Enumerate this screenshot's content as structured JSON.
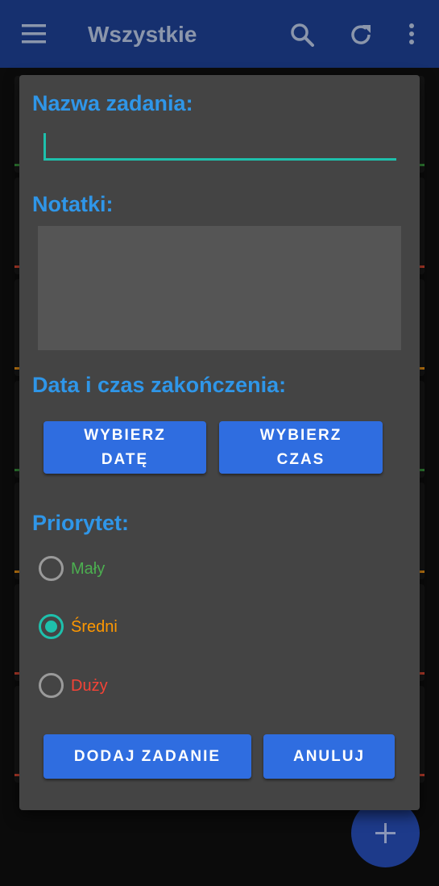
{
  "appbar": {
    "title": "Wszystkie",
    "icons": [
      "menu-icon",
      "search-icon",
      "refresh-icon",
      "more-vert-icon"
    ],
    "color": "#16306f"
  },
  "dialog": {
    "name_label": "Nazwa zadania:",
    "name_value": "",
    "notes_label": "Notatki:",
    "notes_value": "",
    "deadline_label": "Data i czas zakończenia:",
    "pick_date_line1": "WYBIERZ",
    "pick_date_line2": "DATĘ",
    "pick_time_line1": "WYBIERZ",
    "pick_time_line2": "CZAS",
    "priority_label": "Priorytet:",
    "priorities": [
      {
        "label": "Mały",
        "color": "#4caf50",
        "selected": false
      },
      {
        "label": "Średni",
        "color": "#ff9800",
        "selected": true
      },
      {
        "label": "Duży",
        "color": "#f44336",
        "selected": false
      }
    ],
    "add_button": "DODAJ ZADANIE",
    "cancel_button": "ANULUJ",
    "accent_color": "#2f96e8",
    "button_color": "#2f6de0"
  },
  "fab": {
    "icon": "plus-icon"
  }
}
